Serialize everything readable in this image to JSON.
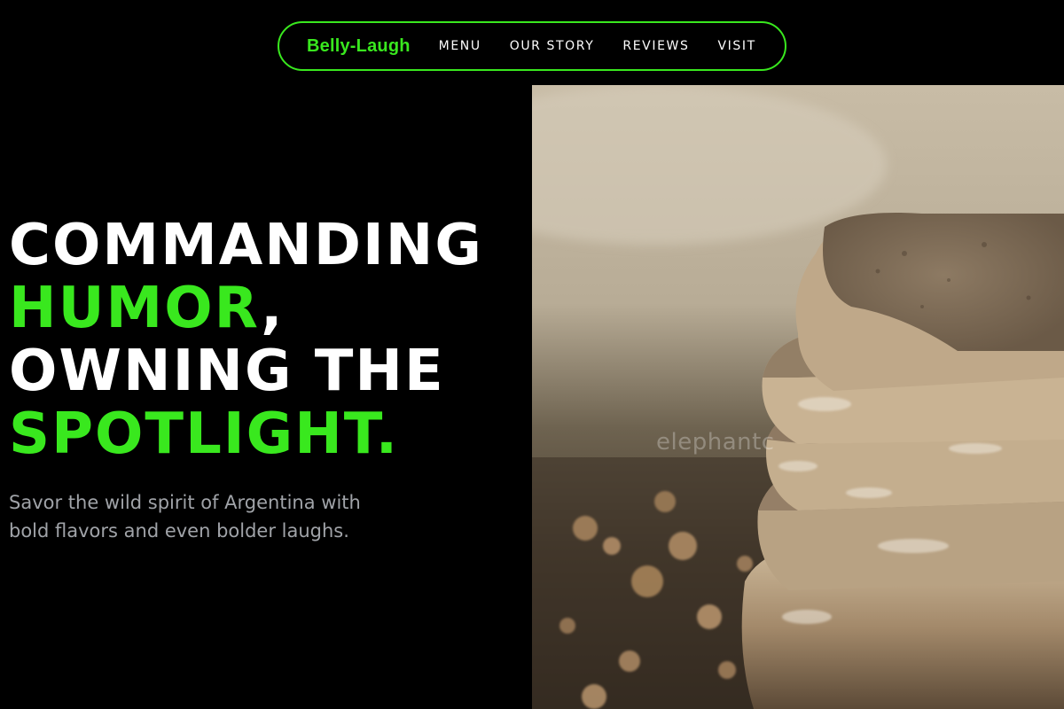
{
  "nav": {
    "brand": "Belly-Laugh",
    "links": [
      "MENU",
      "OUR STORY",
      "REVIEWS",
      "VISIT"
    ]
  },
  "hero": {
    "headline": {
      "line1": "COMMANDING",
      "line2_accent": "HUMOR",
      "line2_rest": ",",
      "line3": "OWNING THE",
      "line4_accent": "SPOTLIGHT."
    },
    "subtext": "Savor the wild spirit of Argentina with bold flavors and even bolder laughs.",
    "image": {
      "subject": "stack of sliced rustic bread loaves",
      "watermark": "elephantc"
    }
  },
  "colors": {
    "background": "#000000",
    "accent": "#39e81e",
    "text": "#ffffff",
    "muted_text": "#a0a3a8"
  }
}
